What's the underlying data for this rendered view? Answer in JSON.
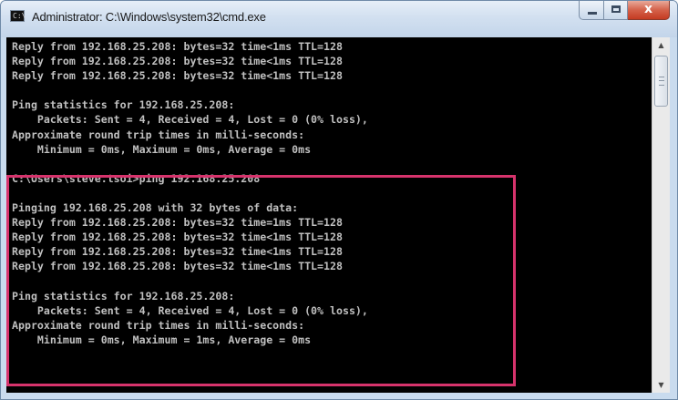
{
  "window": {
    "title": "Administrator: C:\\Windows\\system32\\cmd.exe",
    "app_icon_text": "C:\\",
    "close_glyph": "x"
  },
  "console": {
    "lines": [
      "Reply from 192.168.25.208: bytes=32 time<1ms TTL=128",
      "Reply from 192.168.25.208: bytes=32 time<1ms TTL=128",
      "Reply from 192.168.25.208: bytes=32 time<1ms TTL=128",
      "",
      "Ping statistics for 192.168.25.208:",
      "    Packets: Sent = 4, Received = 4, Lost = 0 (0% loss),",
      "Approximate round trip times in milli-seconds:",
      "    Minimum = 0ms, Maximum = 0ms, Average = 0ms",
      "",
      "C:\\Users\\steve.tsoi>ping 192.168.25.208",
      "",
      "Pinging 192.168.25.208 with 32 bytes of data:",
      "Reply from 192.168.25.208: bytes=32 time=1ms TTL=128",
      "Reply from 192.168.25.208: bytes=32 time<1ms TTL=128",
      "Reply from 192.168.25.208: bytes=32 time<1ms TTL=128",
      "Reply from 192.168.25.208: bytes=32 time<1ms TTL=128",
      "",
      "Ping statistics for 192.168.25.208:",
      "    Packets: Sent = 4, Received = 4, Lost = 0 (0% loss),",
      "Approximate round trip times in milli-seconds:",
      "    Minimum = 0ms, Maximum = 1ms, Average = 0ms"
    ]
  },
  "scrollbar": {
    "up_arrow_icon": "scroll-up-arrow",
    "down_arrow_icon": "scroll-down-arrow"
  },
  "colors": {
    "console_bg": "#000000",
    "console_text": "#c0c0c0",
    "highlight": "#d6336c"
  }
}
